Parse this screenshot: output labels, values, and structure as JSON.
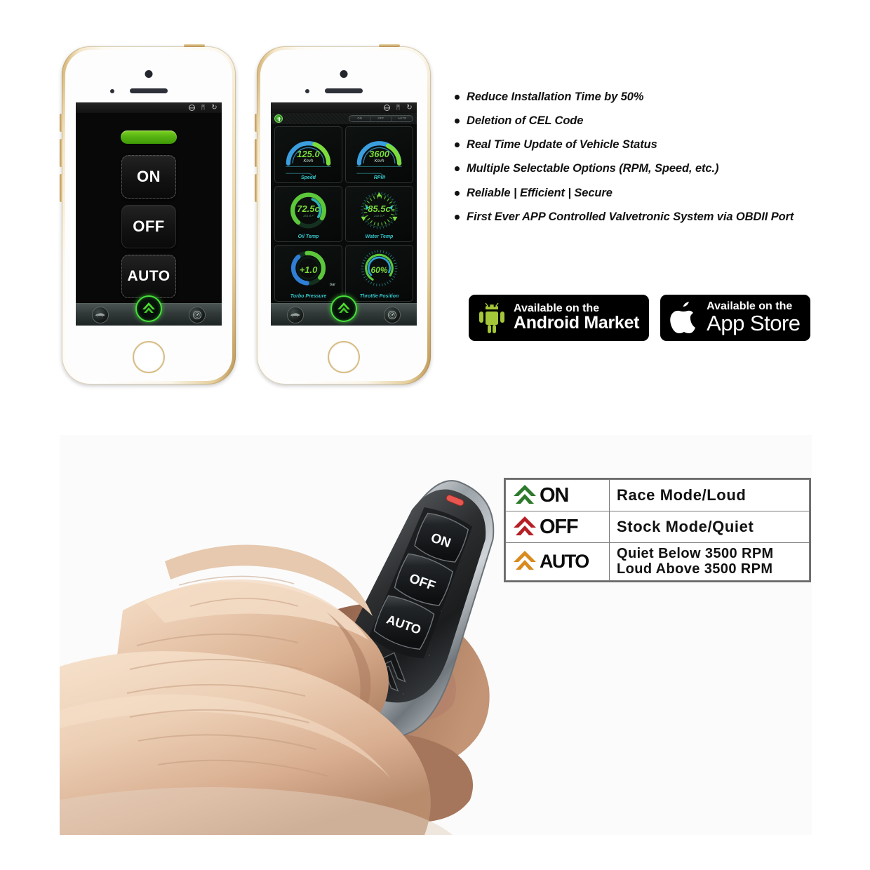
{
  "features": {
    "items": [
      "Reduce Installation Time by 50%",
      "Deletion of CEL Code",
      "Real Time Update of Vehicle Status",
      "Multiple Selectable Options (RPM, Speed, etc.)",
      "Reliable | Efficient | Secure",
      "First Ever APP Controlled Valvetronic System via OBDII Port"
    ]
  },
  "badges": {
    "android": {
      "icon": "android-robot-icon",
      "line1": "Available on the",
      "line2": "Android Market",
      "color": "#a4c639"
    },
    "apple": {
      "icon": "apple-logo-icon",
      "line1": "Available on the",
      "line2": "App Store",
      "color": "#ffffff"
    }
  },
  "phone_control": {
    "statusbar": {
      "icons": [
        "globe-icon",
        "bluetooth-icon",
        "refresh-icon"
      ],
      "bluetooth_glyph": "ᛗ",
      "refresh_glyph": "↻"
    },
    "status_indicator": {
      "name": "connection-status-pill",
      "color": "#57b312",
      "state": "active"
    },
    "buttons": [
      {
        "label": "ON",
        "name": "mode-button-on"
      },
      {
        "label": "OFF",
        "name": "mode-button-off"
      },
      {
        "label": "AUTO",
        "name": "mode-button-auto"
      }
    ],
    "toolbar": {
      "left_icon": "car-icon",
      "center_icon": "valvetronic-logo-icon",
      "right_icon": "gauge-settings-icon",
      "accent": "#46e03a"
    }
  },
  "phone_gauges": {
    "statusbar": {
      "icons": [
        "globe-icon",
        "bluetooth-icon",
        "refresh-icon"
      ],
      "bluetooth_glyph": "ᛗ",
      "refresh_glyph": "↻"
    },
    "topbar": {
      "add_button": "add-gauge-button",
      "segments": [
        "ON",
        "OFF",
        "AUTO"
      ]
    },
    "gauges": [
      {
        "name": "gauge-speed",
        "value": "125.0",
        "unit": "Km/h",
        "sub": "",
        "label": "Speed",
        "pct": 62,
        "style": "arc"
      },
      {
        "name": "gauge-rpm",
        "value": "3600",
        "unit": "Km/h",
        "sub": "",
        "label": "RPM",
        "pct": 52,
        "style": "arc"
      },
      {
        "name": "gauge-oil-temp",
        "value": "72.5c",
        "unit": "",
        "sub": "161.6 F",
        "label": "Oil Temp",
        "pct": 72,
        "style": "ring"
      },
      {
        "name": "gauge-water-temp",
        "value": "85.5c",
        "unit": "",
        "sub": "242.0 F",
        "label": "Water Temp",
        "pct": 58,
        "style": "ticks"
      },
      {
        "name": "gauge-turbo-pressure",
        "value": "+1.0",
        "unit": "bar",
        "sub": "",
        "label": "Turbo Pressure",
        "pct": 55,
        "style": "ring"
      },
      {
        "name": "gauge-throttle-position",
        "value": "60%",
        "unit": "",
        "sub": "",
        "label": "Throttle Position",
        "pct": 60,
        "style": "ticks"
      }
    ],
    "toolbar": {
      "left_icon": "car-icon",
      "center_icon": "valvetronic-logo-icon",
      "right_icon": "gauge-settings-icon",
      "accent": "#46e03a"
    },
    "colors": {
      "value_green": "#7bdc3a",
      "label_cyan": "#35c6ca",
      "arc_blue": "#3b9ede"
    }
  },
  "remote": {
    "name": "key-fob-remote",
    "led_color": "#e8564f",
    "buttons": [
      "ON",
      "OFF",
      "AUTO"
    ],
    "body_logo": "chevron-logo-icon"
  },
  "legend": {
    "rows": [
      {
        "icon": "chevron-logo-icon",
        "icon_color": "#2d7a2d",
        "mode": "ON",
        "desc_line1": "Race Mode/Loud",
        "desc_line2": ""
      },
      {
        "icon": "chevron-logo-icon",
        "icon_color": "#b51f25",
        "mode": "OFF",
        "desc_line1": "Stock Mode/Quiet",
        "desc_line2": ""
      },
      {
        "icon": "chevron-logo-icon",
        "icon_color": "#d98a1e",
        "mode": "AUTO",
        "desc_line1": "Quiet Below 3500 RPM",
        "desc_line2": "Loud Above 3500 RPM"
      }
    ]
  }
}
